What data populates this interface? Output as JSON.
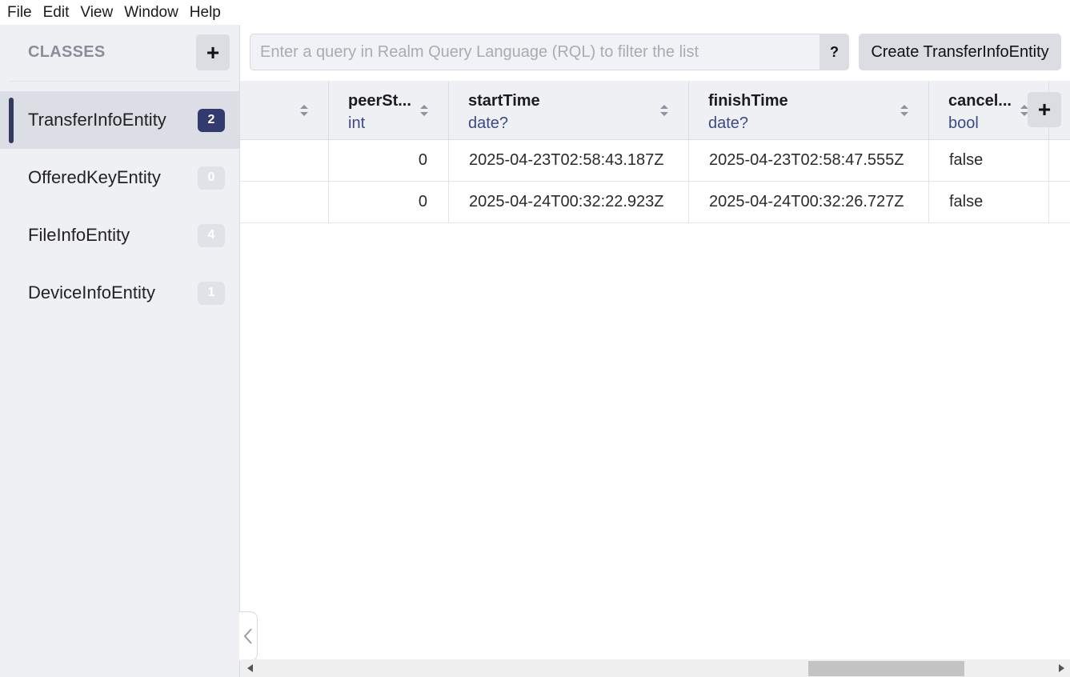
{
  "menu": {
    "items": [
      {
        "label": "File"
      },
      {
        "label": "Edit"
      },
      {
        "label": "View"
      },
      {
        "label": "Window"
      },
      {
        "label": "Help"
      }
    ]
  },
  "sidebar": {
    "title": "CLASSES",
    "add_label": "+",
    "collapse_icon": "chevron-left-icon",
    "classes": [
      {
        "name": "TransferInfoEntity",
        "count": "2",
        "selected": true
      },
      {
        "name": "OfferedKeyEntity",
        "count": "0",
        "selected": false
      },
      {
        "name": "FileInfoEntity",
        "count": "4",
        "selected": false
      },
      {
        "name": "DeviceInfoEntity",
        "count": "1",
        "selected": false
      }
    ]
  },
  "query": {
    "placeholder": "Enter a query in Realm Query Language (RQL) to filter the list",
    "value": "",
    "help_label": "?",
    "create_label": "Create TransferInfoEntity"
  },
  "table": {
    "add_column_label": "+",
    "columns": [
      {
        "name": "",
        "type": ""
      },
      {
        "name": "peerSt...",
        "type": "int"
      },
      {
        "name": "startTime",
        "type": "date?"
      },
      {
        "name": "finishTime",
        "type": "date?"
      },
      {
        "name": "cancel...",
        "type": "bool"
      }
    ],
    "rows": [
      {
        "cells": [
          "",
          "0",
          "2025-04-23T02:58:43.187Z",
          "2025-04-23T02:58:47.555Z",
          "false"
        ]
      },
      {
        "cells": [
          "",
          "0",
          "2025-04-24T00:32:22.923Z",
          "2025-04-24T00:32:26.727Z",
          "false"
        ]
      }
    ]
  },
  "colors": {
    "accent": "#323a6e",
    "type_text": "#3b4a86",
    "sidebar_bg": "#eff0f4"
  }
}
